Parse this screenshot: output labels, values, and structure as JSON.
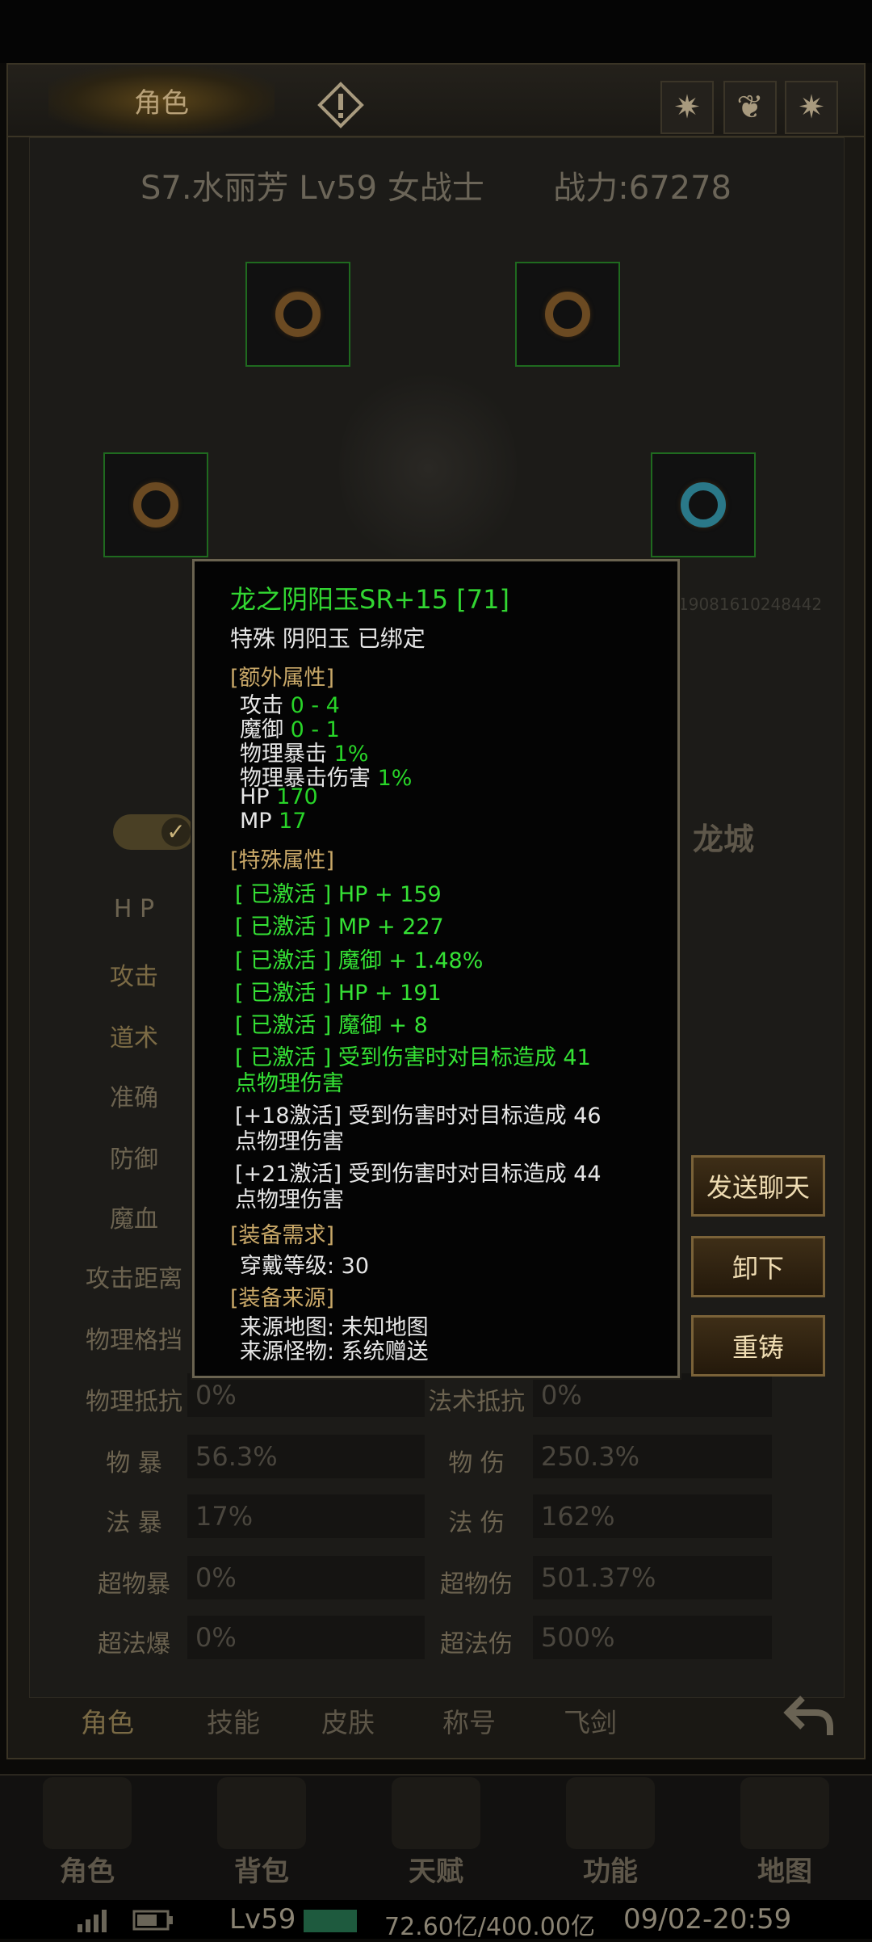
{
  "header": {
    "role_tab": "角色",
    "character_line": "S7.水丽芳 Lv59 女战士",
    "power": "战力:67278"
  },
  "background_text": {
    "faded_id": "19081610248442",
    "city": "龙城"
  },
  "stats": {
    "left_labels": [
      "H P",
      "攻击",
      "道术",
      "准确",
      "防御",
      "魔血",
      "攻击距离",
      "物理格挡",
      "物理抵抗",
      "物 暴",
      "法 暴",
      "超物暴",
      "超法爆"
    ],
    "right_labels": [
      "法术抵抗",
      "物 伤",
      "法 伤",
      "超物伤",
      "超法伤"
    ],
    "left_values": {
      "phys_resist": "0%",
      "phys_crit": "56.3%",
      "magic_crit": "17%",
      "super_phys_crit": "0%",
      "super_magic_crit": "0%"
    },
    "right_values": {
      "magic_resist": "0%",
      "phys_dmg": "250.3%",
      "magic_dmg": "162%",
      "super_phys_dmg": "501.37%",
      "super_magic_dmg": "500%"
    }
  },
  "tooltip": {
    "name": "龙之阴阳玉SR+15 [71]",
    "subtitle": "特殊 阴阳玉 已绑定",
    "extra_header": "[额外属性]",
    "extra": [
      {
        "label": "攻击",
        "value": "0 - 4"
      },
      {
        "label": "魔御",
        "value": "0 - 1"
      },
      {
        "label": "物理暴击",
        "value": "1%"
      },
      {
        "label": "物理暴击伤害",
        "value": "1%"
      },
      {
        "label": "HP",
        "value": "170"
      },
      {
        "label": "MP",
        "value": "17"
      }
    ],
    "special_header": "[特殊属性]",
    "special": [
      "[  已激活 ] HP + 159",
      "[  已激活 ] MP + 227",
      "[  已激活 ] 魔御 + 1.48%",
      "[  已激活 ] HP + 191",
      "[  已激活 ] 魔御 + 8"
    ],
    "special_long_1": "[  已激活 ] 受到伤害时对目标造成 41",
    "special_long_1b": "点物理伤害",
    "inactive_1": "[+18激活] 受到伤害时对目标造成 46",
    "inactive_1b": "点物理伤害",
    "inactive_2": "[+21激活] 受到伤害时对目标造成 44",
    "inactive_2b": "点物理伤害",
    "req_header": "[装备需求]",
    "req": "穿戴等级: 30",
    "source_header": "[装备来源]",
    "source_map": "来源地图:   未知地图",
    "source_monster": "来源怪物:   系统赠送"
  },
  "buttons": {
    "send_chat": "发送聊天",
    "unequip": "卸下",
    "recast": "重铸"
  },
  "bottom_tabs": [
    "角色",
    "技能",
    "皮肤",
    "称号",
    "飞剑"
  ],
  "nav": [
    "角色",
    "背包",
    "天赋",
    "功能",
    "地图"
  ],
  "status_bar": {
    "level": "Lv59",
    "exp": "72.60亿/400.00亿",
    "time": "09/02-20:59"
  },
  "colors": {
    "accent_gold": "#c9a868",
    "active_green": "#28d428"
  }
}
